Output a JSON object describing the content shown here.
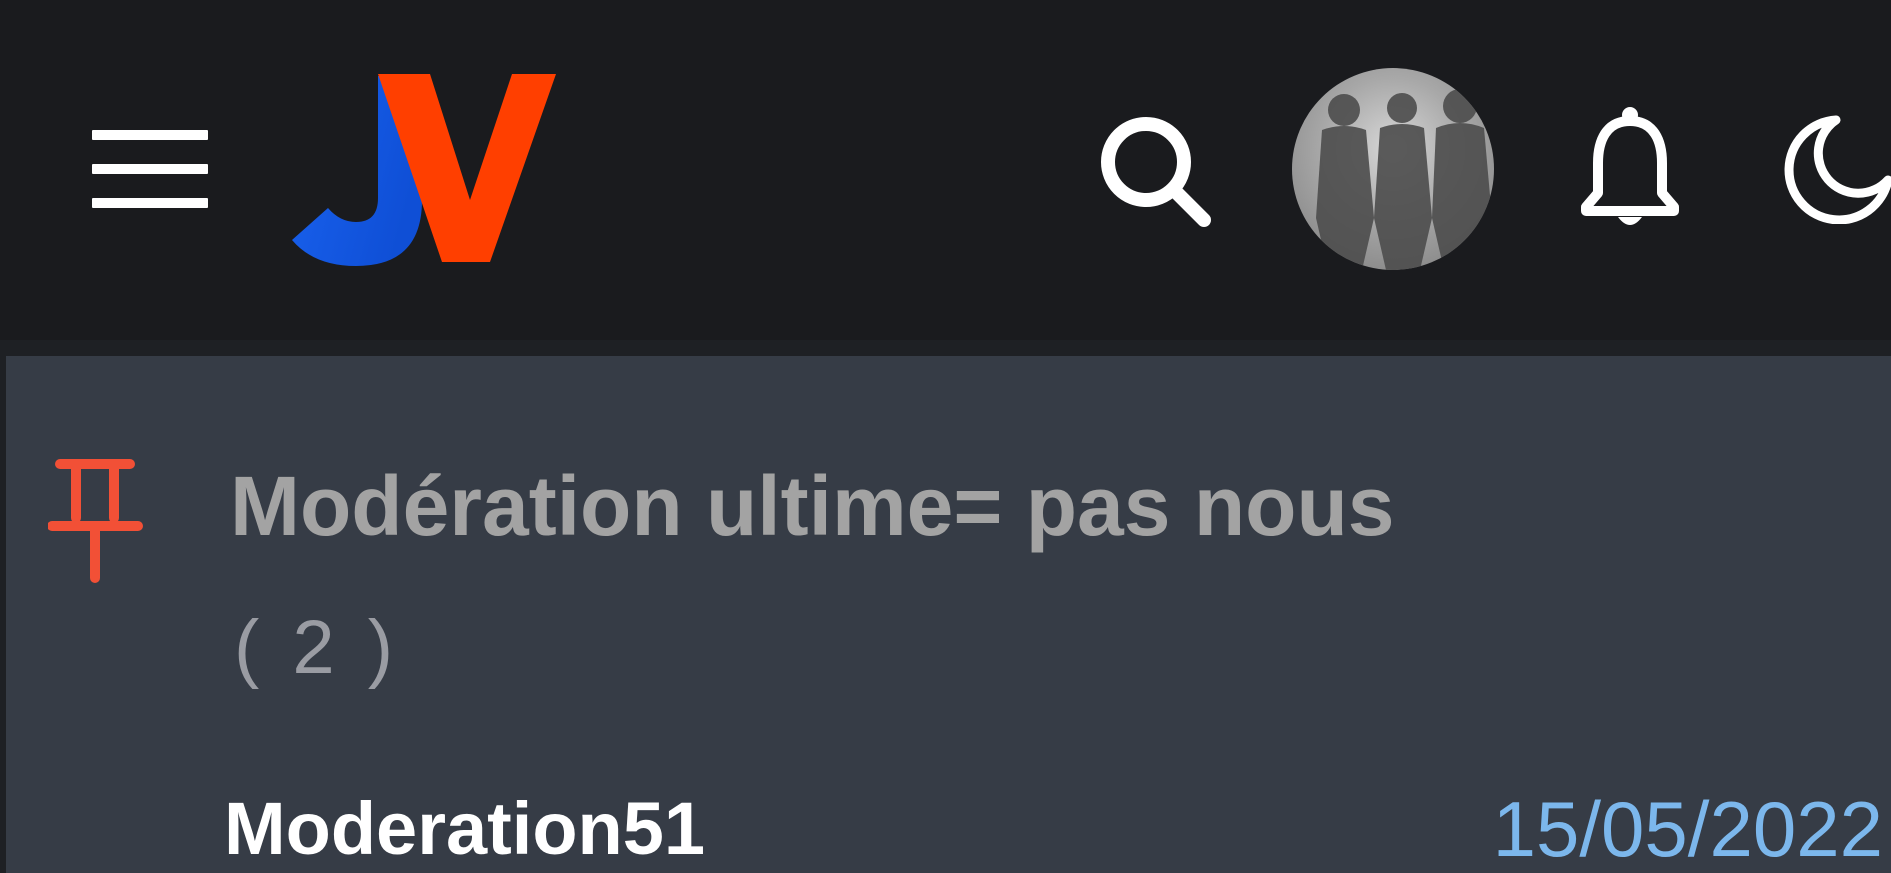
{
  "header": {
    "menu_icon": "hamburger-menu-icon",
    "logo_icon": "jv-logo-icon",
    "search_icon": "search-icon",
    "avatar_icon": "user-avatar",
    "notifications_icon": "bell-icon",
    "theme_icon": "moon-icon"
  },
  "colors": {
    "header_bg": "#1a1b1e",
    "card_bg": "#363c46",
    "pin": "#f25036",
    "logo_blue": "#1a63f0",
    "logo_orange": "#ff3f00",
    "date": "#7cb7ec"
  },
  "topic": {
    "pinned_icon": "pin-icon",
    "title": "Modération ultime= pas nous",
    "reply_count": "( 2 )",
    "author": "Moderation51",
    "date": "15/05/2022"
  }
}
